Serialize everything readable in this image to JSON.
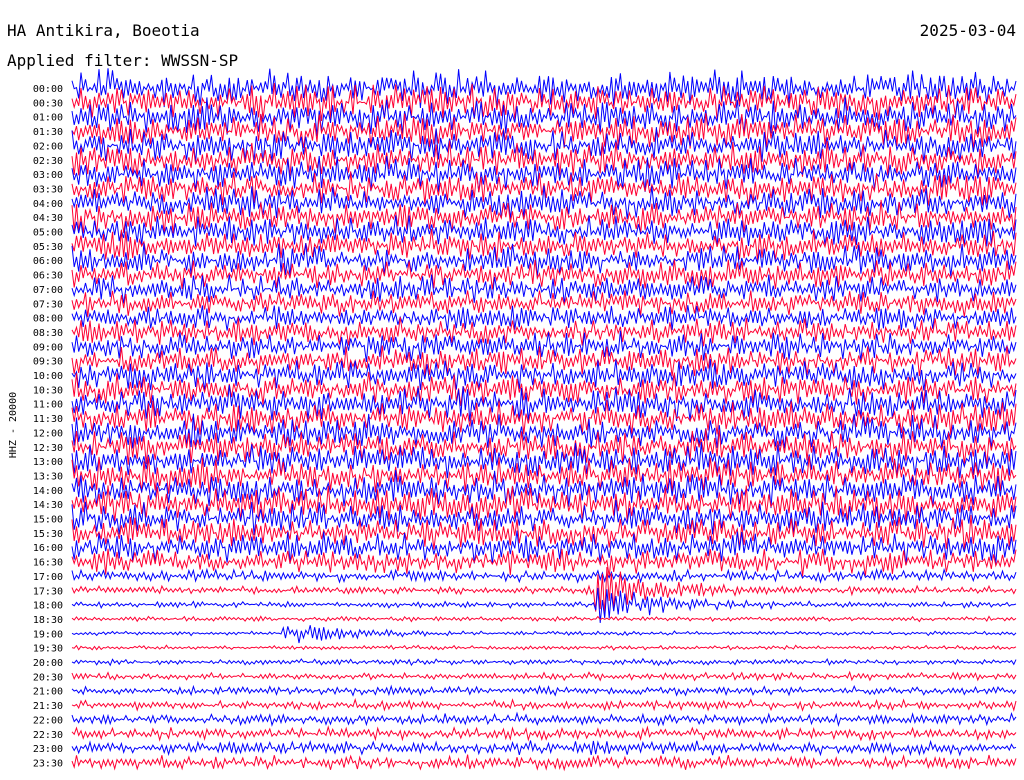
{
  "header": {
    "station": "HA Antikira, Boeotia",
    "date": "2025-03-04",
    "filter": "Applied filter: WWSSN-SP"
  },
  "colors": {
    "background": "#ffffff",
    "text": "#000000",
    "trace_a": "#0000ff",
    "trace_b": "#ff0033"
  },
  "chart_data": {
    "type": "line",
    "subtype": "helicorder",
    "ylabel": "HHZ - 20000",
    "grid": false,
    "legend": "none",
    "row_interval_minutes": 30,
    "row_colors_alternating": [
      "#0000ff",
      "#ff0033"
    ],
    "row_labels": [
      "00:00",
      "00:30",
      "01:00",
      "01:30",
      "02:00",
      "02:30",
      "03:00",
      "03:30",
      "04:00",
      "04:30",
      "05:00",
      "05:30",
      "06:00",
      "06:30",
      "07:00",
      "07:30",
      "08:00",
      "08:30",
      "09:00",
      "09:30",
      "10:00",
      "10:30",
      "11:00",
      "11:30",
      "12:00",
      "12:30",
      "13:00",
      "13:30",
      "14:00",
      "14:30",
      "15:00",
      "15:30",
      "16:00",
      "16:30",
      "17:00",
      "17:30",
      "18:00",
      "18:30",
      "19:00",
      "19:30",
      "20:00",
      "20:30",
      "21:00",
      "21:30",
      "22:00",
      "22:30",
      "23:00",
      "23:30"
    ],
    "relative_amplitude": [
      3.0,
      2.9,
      2.9,
      2.8,
      2.8,
      2.8,
      2.7,
      2.7,
      2.6,
      2.6,
      2.5,
      2.5,
      2.5,
      2.3,
      2.2,
      2.1,
      2.0,
      2.2,
      2.3,
      2.4,
      2.5,
      2.6,
      2.7,
      2.7,
      2.8,
      2.8,
      2.8,
      2.9,
      2.9,
      2.8,
      2.7,
      2.7,
      2.6,
      2.2,
      1.0,
      0.7,
      0.5,
      0.4,
      0.35,
      0.35,
      0.5,
      0.6,
      0.7,
      0.8,
      0.9,
      1.0,
      1.1,
      1.2
    ],
    "events": [
      {
        "row": "17:30",
        "minute": 17,
        "relative_amplitude": 3.0
      },
      {
        "row": "18:00",
        "minute": 17,
        "relative_amplitude": 2.5
      },
      {
        "row": "19:00",
        "minute": 7,
        "relative_amplitude": 1.5
      }
    ]
  }
}
